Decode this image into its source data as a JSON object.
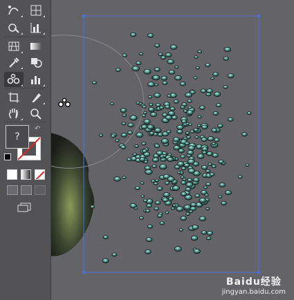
{
  "toolbar": {
    "tools": [
      {
        "id": "curvature",
        "icon": "curvature-pen-icon"
      },
      {
        "id": "mesh",
        "icon": "mesh-tool-icon"
      },
      {
        "id": "shape-builder",
        "icon": "shape-builder-icon"
      },
      {
        "id": "graph",
        "icon": "column-graph-icon"
      },
      {
        "id": "perspective",
        "icon": "perspective-grid-icon"
      },
      {
        "id": "gradient",
        "icon": "gradient-tool-icon"
      },
      {
        "id": "eyedropper",
        "icon": "eyedropper-icon"
      },
      {
        "id": "blend",
        "icon": "blend-tool-icon"
      },
      {
        "id": "symbol-sprayer",
        "icon": "symbol-sprayer-icon",
        "active": true
      },
      {
        "id": "column-graph",
        "icon": "bar-graph-icon"
      },
      {
        "id": "artboard",
        "icon": "artboard-tool-icon"
      },
      {
        "id": "slice",
        "icon": "slice-tool-icon"
      },
      {
        "id": "hand",
        "icon": "hand-tool-icon"
      },
      {
        "id": "zoom",
        "icon": "zoom-tool-icon"
      }
    ],
    "fill_label": "?",
    "fill_stroke": {
      "fill": "none",
      "stroke": "none"
    }
  },
  "colors": {
    "canvas": "#646468",
    "toolbar": "#535356",
    "selection": "#4a6fe0",
    "drop": "#1e2a2a",
    "drop_highlight": "#8fe0d0"
  },
  "watermark": {
    "brand": "Baidu经验",
    "url": "jingyan.baidu.com"
  }
}
